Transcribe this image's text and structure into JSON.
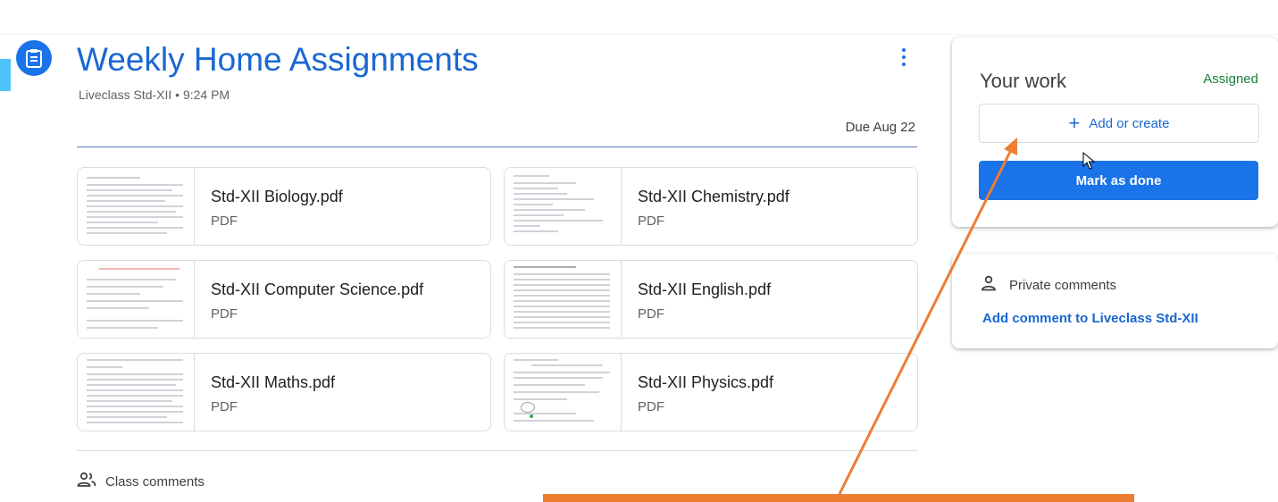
{
  "assignment": {
    "title": "Weekly Home Assignments",
    "subtitle": "Liveclass Std-XII • 9:24 PM",
    "due": "Due Aug 22"
  },
  "attachments": [
    {
      "name": "Std-XII Biology.pdf",
      "type": "PDF"
    },
    {
      "name": "Std-XII Chemistry.pdf",
      "type": "PDF"
    },
    {
      "name": "Std-XII Computer Science.pdf",
      "type": "PDF"
    },
    {
      "name": "Std-XII English.pdf",
      "type": "PDF"
    },
    {
      "name": "Std-XII Maths.pdf",
      "type": "PDF"
    },
    {
      "name": "Std-XII Physics.pdf",
      "type": "PDF"
    }
  ],
  "class_comments": {
    "label": "Class comments"
  },
  "your_work": {
    "title": "Your work",
    "status": "Assigned",
    "add_label": "Add or create",
    "done_label": "Mark as done"
  },
  "private_comments": {
    "label": "Private comments",
    "add_link": "Add comment to Liveclass Std-XII"
  },
  "colors": {
    "accent": "#1a73e8",
    "status_green": "#188038",
    "annotation_orange": "#ed7d31"
  },
  "icons": {
    "assignment": "assignment-icon",
    "more": "more-vert-icon",
    "add": "plus-icon",
    "person": "person-icon",
    "people": "people-icon"
  }
}
